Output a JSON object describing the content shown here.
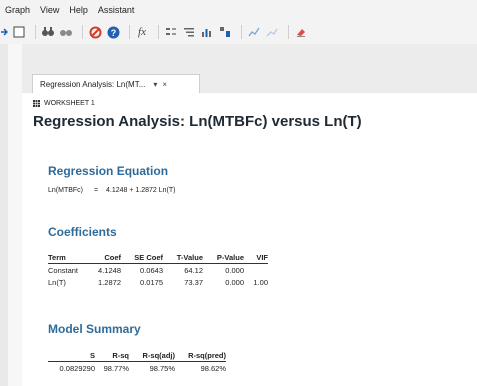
{
  "menu": [
    "Graph",
    "View",
    "Help",
    "Assistant"
  ],
  "toolbar": {
    "icons": [
      "arrow-right-icon",
      "window-icon",
      "binoculars-icon",
      "find-next-icon",
      "cancel-icon",
      "help-icon",
      "function-icon",
      "align-icon",
      "sort-icon",
      "bar-chart-icon",
      "chart-icon",
      "line-chart-icon",
      "brush-icon",
      "eraser-icon"
    ],
    "function_glyph": "fx"
  },
  "tab": {
    "label": "Regression Analysis: Ln(MT...",
    "dropdown": "▾",
    "close": "×"
  },
  "worksheet": {
    "label": "WORKSHEET 1"
  },
  "title": "Regression Analysis: Ln(MTBFc) versus Ln(T)",
  "equation": {
    "heading": "Regression Equation",
    "lhs": "Ln(MTBFc)",
    "equals": "=",
    "rhs": "4.1248 + 1.2872 Ln(T)"
  },
  "coefficients": {
    "heading": "Coefficients",
    "columns": [
      "Term",
      "Coef",
      "SE Coef",
      "T-Value",
      "P-Value",
      "VIF"
    ],
    "rows": [
      [
        "Constant",
        "4.1248",
        "0.0643",
        "64.12",
        "0.000",
        ""
      ],
      [
        "Ln(T)",
        "1.2872",
        "0.0175",
        "73.37",
        "0.000",
        "1.00"
      ]
    ]
  },
  "model_summary": {
    "heading": "Model Summary",
    "columns": [
      "S",
      "R-sq",
      "R-sq(adj)",
      "R-sq(pred)"
    ],
    "rows": [
      [
        "0.0829290",
        "98.77%",
        "98.75%",
        "98.62%"
      ]
    ]
  },
  "colors": {
    "heading_blue": "#2f6b9a",
    "cancel_red": "#d23b2a",
    "help_blue": "#1f5fb6",
    "eraser_red": "#e24c4c"
  }
}
